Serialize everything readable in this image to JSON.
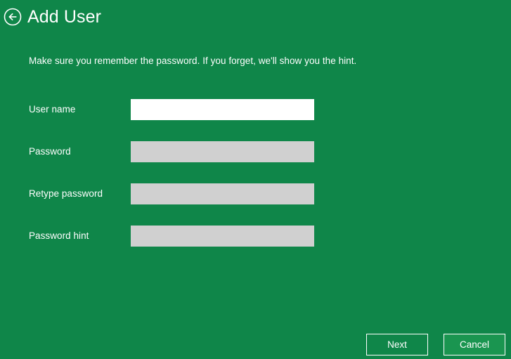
{
  "window": {
    "background_color": "#0f8649",
    "accent_color": "#1a9550"
  },
  "header": {
    "back_icon": "back-arrow-circle-icon",
    "title": "Add User"
  },
  "instruction": "Make sure you remember the password. If you forget, we'll show you the hint.",
  "form": {
    "fields": [
      {
        "label": "User name",
        "value": "",
        "placeholder": "",
        "state": "focused",
        "type": "text"
      },
      {
        "label": "Password",
        "value": "",
        "placeholder": "",
        "state": "normal",
        "type": "password"
      },
      {
        "label": "Retype password",
        "value": "",
        "placeholder": "",
        "state": "normal",
        "type": "password"
      },
      {
        "label": "Password hint",
        "value": "",
        "placeholder": "",
        "state": "normal",
        "type": "text"
      }
    ]
  },
  "footer": {
    "next_label": "Next",
    "cancel_label": "Cancel"
  }
}
